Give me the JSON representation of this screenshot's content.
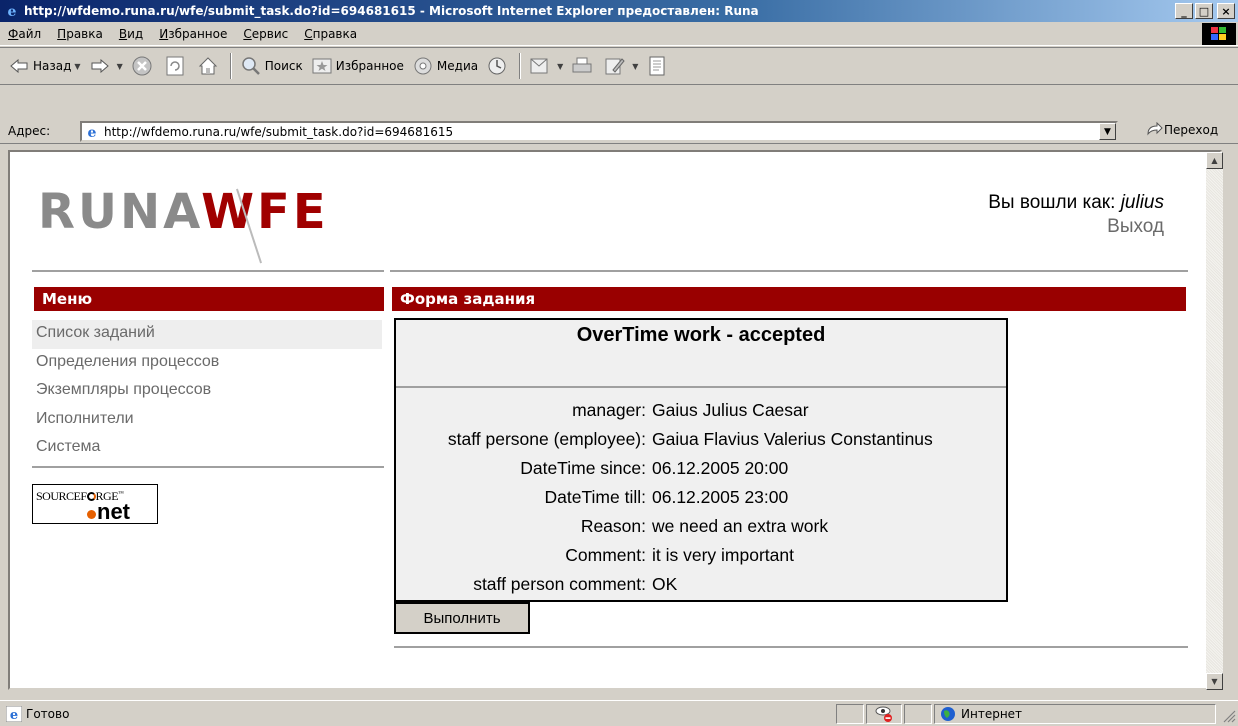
{
  "window": {
    "title": "http://wfdemo.runa.ru/wfe/submit_task.do?id=694681615 - Microsoft Internet Explorer предоставлен: Runa",
    "buttons": {
      "minimize": "_",
      "maximize": "□",
      "close": "×"
    }
  },
  "menubar": {
    "items": [
      {
        "underlined": "Ф",
        "rest": "айл"
      },
      {
        "underlined": "П",
        "rest": "равка"
      },
      {
        "underlined": "В",
        "rest": "ид"
      },
      {
        "underlined": "И",
        "rest": "збранное"
      },
      {
        "underlined": "С",
        "rest": "ервис"
      },
      {
        "underlined": "С",
        "rest": "правка"
      }
    ]
  },
  "toolbar": {
    "back_label": "Назад",
    "search_label": "Поиск",
    "favorites_label": "Избранное",
    "media_label": "Медиа"
  },
  "address": {
    "label": "Адрес:",
    "url": "http://wfdemo.runa.ru/wfe/submit_task.do?id=694681615",
    "go_label": "Переход"
  },
  "page": {
    "logo_part1": "RUNA",
    "logo_part2": "WFE",
    "login_prefix": "Вы вошли как:",
    "login_user": "julius",
    "logout_label": "Выход",
    "menu_title": "Меню",
    "menu_items": [
      "Список заданий",
      "Определения процессов",
      "Экземпляры процессов",
      "Исполнители",
      "Система"
    ],
    "sourceforge": {
      "part1": "SOURCEF",
      "part2": "RGE",
      "tm": "™",
      "net": "net"
    },
    "form_header": "Форма задания",
    "form_title": "OverTime work - accepted",
    "fields": [
      {
        "key": "manager:",
        "value": "Gaius Julius Caesar"
      },
      {
        "key": "staff persone (employee):",
        "value": "Gaiua Flavius Valerius Constantinus"
      },
      {
        "key": "DateTime since:",
        "value": "06.12.2005 20:00"
      },
      {
        "key": "DateTime till:",
        "value": "06.12.2005 23:00"
      },
      {
        "key": "Reason:",
        "value": "we need an extra work"
      },
      {
        "key": "Comment:",
        "value": "it is very important"
      },
      {
        "key": "staff person comment:",
        "value": "OK"
      }
    ],
    "submit_label": "Выполнить"
  },
  "statusbar": {
    "status": "Готово",
    "zone": "Интернет"
  },
  "colors": {
    "accent_red": "#990000",
    "title_blue": "#0a246a"
  }
}
